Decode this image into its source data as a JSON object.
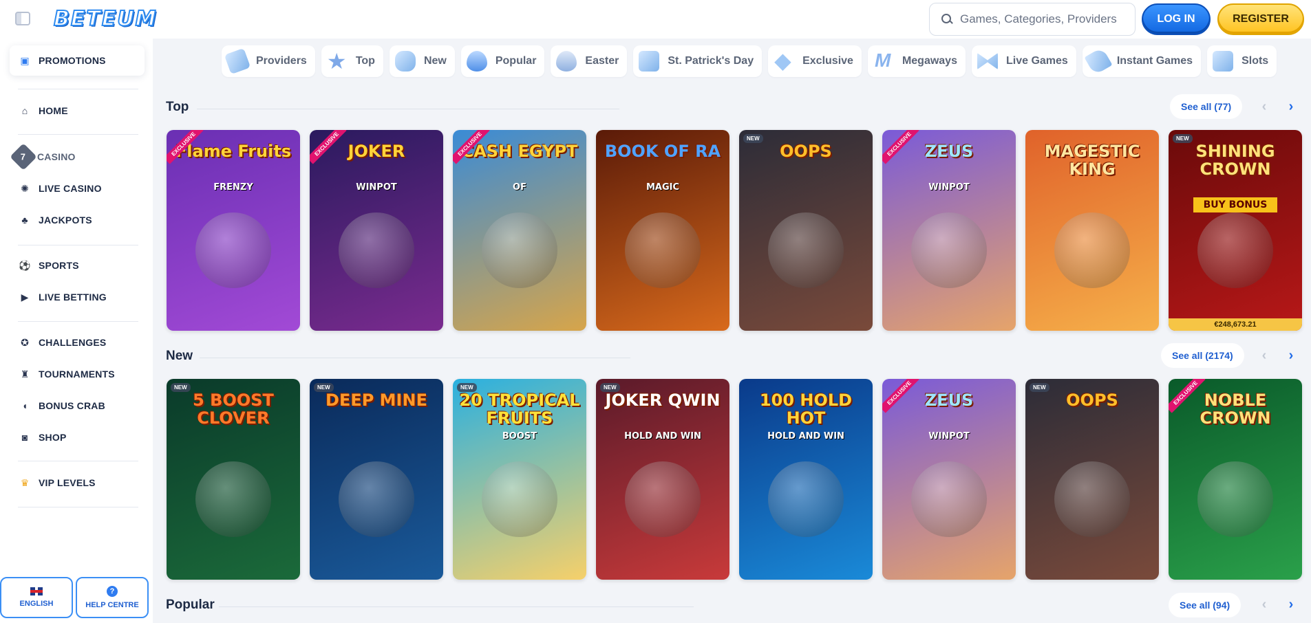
{
  "header": {
    "logo": "BETEUM",
    "search_placeholder": "Games, Categories, Providers",
    "login_label": "LOG IN",
    "register_label": "REGISTER"
  },
  "sidebar": {
    "items": [
      {
        "label": "PROMOTIONS",
        "icon": "gift-icon"
      },
      {
        "label": "HOME",
        "icon": "home-icon"
      },
      {
        "label": "CASINO",
        "icon": "casino-seven-icon"
      },
      {
        "label": "LIVE CASINO",
        "icon": "chip-icon"
      },
      {
        "label": "JACKPOTS",
        "icon": "clover-icon"
      },
      {
        "label": "SPORTS",
        "icon": "football-icon"
      },
      {
        "label": "LIVE BETTING",
        "icon": "live-icon"
      },
      {
        "label": "CHALLENGES",
        "icon": "medal-icon"
      },
      {
        "label": "TOURNAMENTS",
        "icon": "trophy-icon"
      },
      {
        "label": "BONUS CRAB",
        "icon": "crab-icon"
      },
      {
        "label": "SHOP",
        "icon": "basket-icon"
      },
      {
        "label": "VIP LEVELS",
        "icon": "crown-icon"
      }
    ],
    "language_label": "ENGLISH",
    "help_label": "HELP CENTRE"
  },
  "categories": [
    "Providers",
    "Top",
    "New",
    "Popular",
    "Easter",
    "St. Patrick's Day",
    "Exclusive",
    "Megaways",
    "Live Games",
    "Instant Games",
    "Slots"
  ],
  "sections": {
    "top": {
      "title": "Top",
      "see_all": "See all (77)",
      "games": [
        {
          "title": "Flame Fruits",
          "sub": "FRENZY",
          "badge": "EXCLUSIVE",
          "bg": "#6a2fb3",
          "bg2": "#a24ad6",
          "color": "#ffd43a"
        },
        {
          "title": "JOKER",
          "sub": "WINPOT",
          "badge": "EXCLUSIVE",
          "bg": "#2a1a5e",
          "bg2": "#7a2b8f",
          "color": "#ffd43a"
        },
        {
          "title": "CASH EGYPT",
          "sub": "OF",
          "badge": "EXCLUSIVE",
          "bg": "#3a8bd6",
          "bg2": "#d7a54a",
          "color": "#ffd43a"
        },
        {
          "title": "BOOK OF RA",
          "sub": "MAGIC",
          "badge": "",
          "bg": "#5a1a08",
          "bg2": "#d86a1c",
          "color": "#4fa3ff"
        },
        {
          "title": "OOPS",
          "sub": "",
          "badge": "NEW",
          "bg": "#2c2c38",
          "bg2": "#7a4a3a",
          "color": "#ffbf2a"
        },
        {
          "title": "ZEUS",
          "sub": "WINPOT",
          "badge": "EXCLUSIVE",
          "bg": "#7a5ad8",
          "bg2": "#e6a46a",
          "color": "#9ee6ff"
        },
        {
          "title": "MAGESTIC KING",
          "sub": "",
          "badge": "",
          "bg": "#e0622a",
          "bg2": "#f6b04a",
          "color": "#ffe6a0"
        },
        {
          "title": "SHINING CROWN",
          "sub": "",
          "badge": "NEW",
          "bg": "#6a0a0a",
          "bg2": "#b81818",
          "color": "#ffe27a",
          "buy_bonus": "BUY BONUS",
          "jackpot": "€248,673.21"
        }
      ]
    },
    "new": {
      "title": "New",
      "see_all": "See all (2174)",
      "games": [
        {
          "title": "5 BOOST CLOVER",
          "sub": "",
          "badge": "NEW",
          "bg": "#0a3a2a",
          "bg2": "#1b6a3a",
          "color": "#ff7a2a"
        },
        {
          "title": "DEEP MINE",
          "sub": "",
          "badge": "NEW",
          "bg": "#0a2a5a",
          "bg2": "#1a5a9a",
          "color": "#ff9a2a"
        },
        {
          "title": "20 TROPICAL FRUITS",
          "sub": "BOOST",
          "badge": "NEW",
          "bg": "#2ab0e0",
          "bg2": "#f6d06a",
          "color": "#ffe23a"
        },
        {
          "title": "JOKER QWIN",
          "sub": "HOLD AND WIN",
          "badge": "NEW",
          "bg": "#5a1a2a",
          "bg2": "#c83a3a",
          "color": "#ffffff"
        },
        {
          "title": "100 HOLD HOT",
          "sub": "HOLD AND WIN",
          "badge": "",
          "bg": "#0a3a8a",
          "bg2": "#1a8ad8",
          "color": "#ffd43a"
        },
        {
          "title": "ZEUS",
          "sub": "WINPOT",
          "badge": "EXCLUSIVE",
          "bg": "#7a5ad8",
          "bg2": "#e6a46a",
          "color": "#9ee6ff"
        },
        {
          "title": "OOPS",
          "sub": "",
          "badge": "NEW",
          "bg": "#2c2c38",
          "bg2": "#7a4a3a",
          "color": "#ffbf2a"
        },
        {
          "title": "NOBLE CROWN",
          "sub": "",
          "badge": "EXCLUSIVE",
          "bg": "#0a5a2a",
          "bg2": "#2aa04a",
          "color": "#ffe27a"
        }
      ]
    },
    "popular": {
      "title": "Popular",
      "see_all": "See all (94)"
    }
  },
  "colors": {
    "accent": "#1f6ae8",
    "brand": "#2f8cf0",
    "register": "#ffc21d"
  }
}
